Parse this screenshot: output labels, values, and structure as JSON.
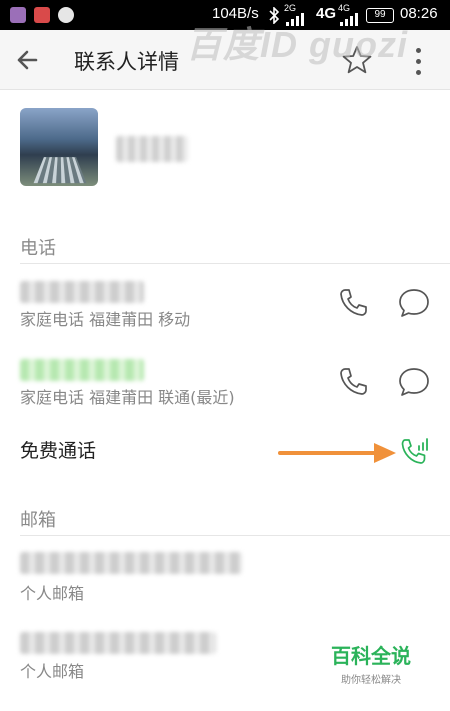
{
  "status_bar": {
    "speed": "104B/s",
    "net_2g": "2G",
    "net_4g": "4G",
    "net_4g_small": "4G",
    "battery": "99",
    "time": "08:26",
    "icons": [
      "gallery-icon",
      "app-icon",
      "qq-icon",
      "bluetooth-icon",
      "signal-icon"
    ]
  },
  "watermark": "百度ID guozi",
  "app_bar": {
    "title": "联系人详情",
    "back_icon": "back-arrow-icon",
    "star_icon": "star-icon",
    "more_icon": "more-vertical-icon"
  },
  "contact": {
    "avatar": "contact-photo"
  },
  "phone_section": {
    "title": "电话",
    "entries": [
      {
        "desc": "家庭电话 福建莆田 移动"
      },
      {
        "desc": "家庭电话 福建莆田 联通(最近)"
      }
    ],
    "free_call_label": "免费通话"
  },
  "email_section": {
    "title": "邮箱",
    "entries": [
      {
        "desc": "个人邮箱"
      },
      {
        "desc": "个人邮箱"
      }
    ]
  },
  "logo": {
    "main": "百科全说",
    "sub": "助你轻松解决"
  },
  "colors": {
    "accent_green": "#2bb35a",
    "arrow_orange": "#f0913a",
    "icon_gray": "#555555"
  }
}
